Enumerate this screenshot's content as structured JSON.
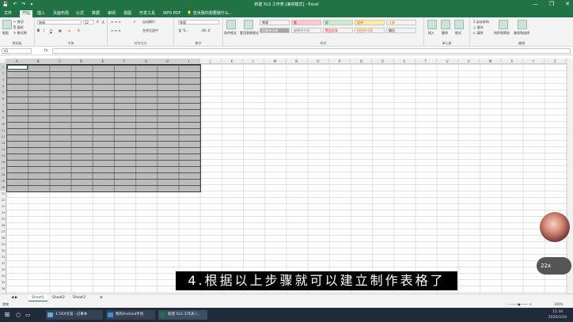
{
  "window": {
    "title": "新建 XLS 工作表 [兼容模式] - Excel",
    "qat": [
      "💾",
      "↶",
      "↷",
      "▾"
    ],
    "controls": [
      "—",
      "❐",
      "✕"
    ]
  },
  "tabs": [
    "文件",
    "开始",
    "插入",
    "页面布局",
    "公式",
    "数据",
    "审阅",
    "视图",
    "开发工具",
    "WPS PDF"
  ],
  "tell_me": "告诉我你想要做什么…",
  "ribbon": {
    "clipboard": {
      "label": "剪贴板",
      "paste": "粘贴",
      "cut": "✂ 剪切",
      "copy": "⎘ 复制",
      "painter": "✎ 格式刷"
    },
    "font": {
      "label": "字体",
      "name": "宋体",
      "size": "12",
      "bold": "B",
      "italic": "I",
      "underline": "U",
      "grow": "A",
      "shrink": "A"
    },
    "alignment": {
      "label": "对齐方式",
      "wrap": "自动换行",
      "merge": "合并后居中"
    },
    "number": {
      "label": "数字",
      "format": "常规"
    },
    "styles": {
      "label": "样式",
      "cond": "条件格式",
      "table": "套用表格格式",
      "cells": [
        {
          "t": "常规",
          "bg": "#ffffff"
        },
        {
          "t": "差",
          "bg": "#ffc7ce"
        },
        {
          "t": "好",
          "bg": "#c6efce"
        },
        {
          "t": "适中",
          "bg": "#ffeb9c"
        },
        {
          "t": "计算",
          "bg": "#f2f2f2"
        },
        {
          "t": "检查单元格",
          "bg": "#a5a5a5"
        },
        {
          "t": "解释性文本",
          "bg": "#ffffff"
        },
        {
          "t": "警告文本",
          "bg": "#ffffff"
        },
        {
          "t": "链接单元格",
          "bg": "#ffffff"
        },
        {
          "t": "输出",
          "bg": "#f2f2f2"
        }
      ]
    },
    "cells": {
      "label": "单元格",
      "insert": "插入",
      "delete": "删除",
      "format": "格式"
    },
    "editing": {
      "label": "编辑",
      "autosum": "Σ 自动求和",
      "fill": "↓ 填充",
      "clear": "◇ 清除",
      "sort": "排序和筛选",
      "find": "查找和选择"
    }
  },
  "formula_bar": {
    "name_box": "A1",
    "fx": "fx",
    "value": ""
  },
  "columns": [
    "A",
    "B",
    "C",
    "D",
    "E",
    "F",
    "G",
    "H",
    "I",
    "J",
    "K",
    "L",
    "M",
    "N",
    "O",
    "P",
    "Q",
    "R",
    "S",
    "T",
    "U",
    "V",
    "W",
    "X",
    "Y",
    "Z"
  ],
  "rows": [
    "1",
    "2",
    "3",
    "4",
    "5",
    "6",
    "7",
    "8",
    "9",
    "10",
    "11",
    "12",
    "13",
    "14",
    "15",
    "16",
    "17",
    "18",
    "19",
    "20",
    "21",
    "22",
    "23",
    "24",
    "25",
    "26",
    "27",
    "28",
    "29",
    "30",
    "31",
    "32",
    "33",
    "34",
    "35",
    "36"
  ],
  "sheets": [
    "Sheet1",
    "Sheet2",
    "Sheet3"
  ],
  "active_sheet": "Sheet1",
  "status": {
    "left": "就绪",
    "zoom": "100%"
  },
  "taskbar": {
    "items": [
      "1.5XX文案 - 记事本",
      "我的Android手机",
      "新建 XLS 工作表 [..."
    ],
    "time": "15:34",
    "date": "2020/3/18"
  },
  "subtitle": "4.根据以上步骤就可以建立制作表格了",
  "zoom_badge": "22x"
}
